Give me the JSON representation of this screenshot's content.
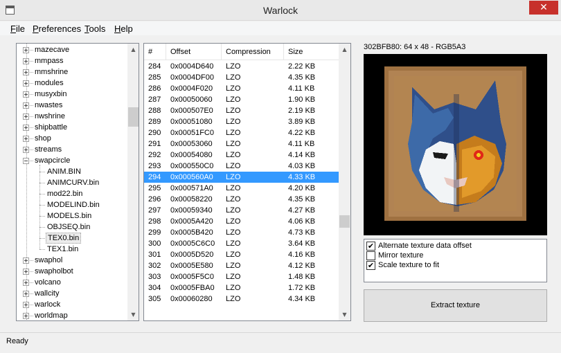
{
  "window": {
    "title": "Warlock",
    "close_glyph": "✕"
  },
  "menu": [
    "File",
    "Preferences",
    "Tools",
    "Help"
  ],
  "tree": {
    "items": [
      {
        "label": "mazecave",
        "type": "folder",
        "expanded": false
      },
      {
        "label": "mmpass",
        "type": "folder",
        "expanded": false
      },
      {
        "label": "mmshrine",
        "type": "folder",
        "expanded": false
      },
      {
        "label": "modules",
        "type": "folder",
        "expanded": false
      },
      {
        "label": "musyxbin",
        "type": "folder",
        "expanded": false
      },
      {
        "label": "nwastes",
        "type": "folder",
        "expanded": false
      },
      {
        "label": "nwshrine",
        "type": "folder",
        "expanded": false
      },
      {
        "label": "shipbattle",
        "type": "folder",
        "expanded": false
      },
      {
        "label": "shop",
        "type": "folder",
        "expanded": false
      },
      {
        "label": "streams",
        "type": "folder",
        "expanded": false
      },
      {
        "label": "swapcircle",
        "type": "folder",
        "expanded": true
      },
      {
        "label": "ANIM.BIN",
        "type": "file"
      },
      {
        "label": "ANIMCURV.bin",
        "type": "file"
      },
      {
        "label": "mod22.bin",
        "type": "file"
      },
      {
        "label": "MODELIND.bin",
        "type": "file"
      },
      {
        "label": "MODELS.bin",
        "type": "file"
      },
      {
        "label": "OBJSEQ.bin",
        "type": "file"
      },
      {
        "label": "TEX0.bin",
        "type": "file",
        "selected": true
      },
      {
        "label": "TEX1.bin",
        "type": "file"
      },
      {
        "label": "swaphol",
        "type": "folder",
        "expanded": false
      },
      {
        "label": "swapholbot",
        "type": "folder",
        "expanded": false
      },
      {
        "label": "volcano",
        "type": "folder",
        "expanded": false
      },
      {
        "label": "wallcity",
        "type": "folder",
        "expanded": false
      },
      {
        "label": "warlock",
        "type": "folder",
        "expanded": false
      },
      {
        "label": "worldmap",
        "type": "folder",
        "expanded": false
      }
    ]
  },
  "list": {
    "columns": [
      "#",
      "Offset",
      "Compression",
      "Size"
    ],
    "rows": [
      [
        "284",
        "0x0004D640",
        "LZO",
        "2.22 KB"
      ],
      [
        "285",
        "0x0004DF00",
        "LZO",
        "4.35 KB"
      ],
      [
        "286",
        "0x0004F020",
        "LZO",
        "4.11 KB"
      ],
      [
        "287",
        "0x00050060",
        "LZO",
        "1.90 KB"
      ],
      [
        "288",
        "0x000507E0",
        "LZO",
        "2.19 KB"
      ],
      [
        "289",
        "0x00051080",
        "LZO",
        "3.89 KB"
      ],
      [
        "290",
        "0x00051FC0",
        "LZO",
        "4.22 KB"
      ],
      [
        "291",
        "0x00053060",
        "LZO",
        "4.11 KB"
      ],
      [
        "292",
        "0x00054080",
        "LZO",
        "4.14 KB"
      ],
      [
        "293",
        "0x000550C0",
        "LZO",
        "4.03 KB"
      ],
      [
        "294",
        "0x000560A0",
        "LZO",
        "4.33 KB"
      ],
      [
        "295",
        "0x000571A0",
        "LZO",
        "4.20 KB"
      ],
      [
        "296",
        "0x00058220",
        "LZO",
        "4.35 KB"
      ],
      [
        "297",
        "0x00059340",
        "LZO",
        "4.27 KB"
      ],
      [
        "298",
        "0x0005A420",
        "LZO",
        "4.06 KB"
      ],
      [
        "299",
        "0x0005B420",
        "LZO",
        "4.73 KB"
      ],
      [
        "300",
        "0x0005C6C0",
        "LZO",
        "3.64 KB"
      ],
      [
        "301",
        "0x0005D520",
        "LZO",
        "4.16 KB"
      ],
      [
        "302",
        "0x0005E580",
        "LZO",
        "4.12 KB"
      ],
      [
        "303",
        "0x0005F5C0",
        "LZO",
        "1.48 KB"
      ],
      [
        "304",
        "0x0005FBA0",
        "LZO",
        "1.72 KB"
      ],
      [
        "305",
        "0x00060280",
        "LZO",
        "4.34 KB"
      ]
    ],
    "selected_index": 10
  },
  "texture": {
    "caption": "302BFB80: 64 x 48 - RGB5A3"
  },
  "options": [
    {
      "label": "Alternate texture data offset",
      "checked": true
    },
    {
      "label": "Mirror texture",
      "checked": false
    },
    {
      "label": "Scale texture to fit",
      "checked": true
    }
  ],
  "check_glyph": "✔",
  "extract_label": "Extract texture",
  "status": "Ready",
  "colors": {
    "selection": "#3399ff",
    "close": "#c7302b"
  }
}
